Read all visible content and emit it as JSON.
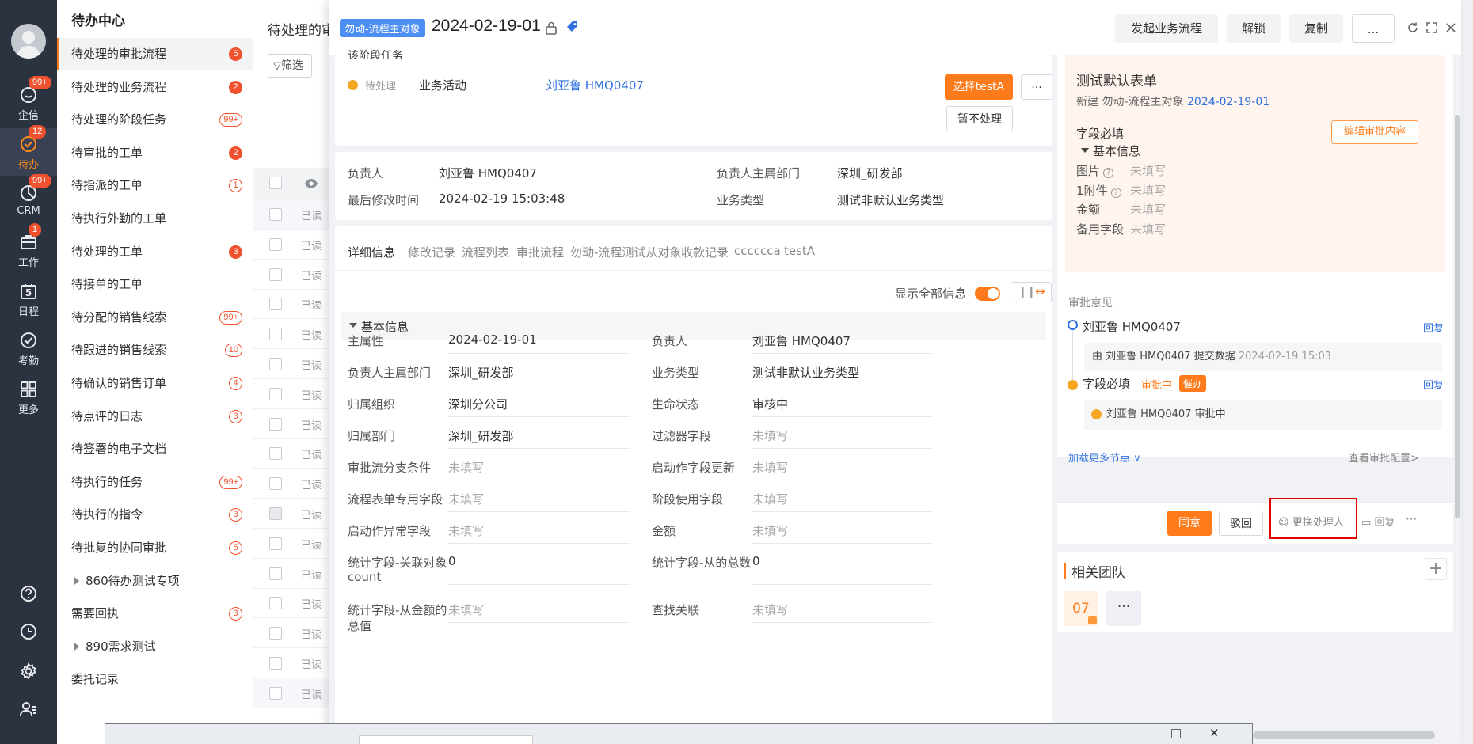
{
  "nav": {
    "items": [
      {
        "label": "企信",
        "badge": "99+",
        "icon": "chat-icon"
      },
      {
        "label": "待办",
        "badge": "12",
        "icon": "todo-icon"
      },
      {
        "label": "CRM",
        "badge": "99+",
        "icon": "crm-icon"
      },
      {
        "label": "工作",
        "badge": "1",
        "icon": "briefcase-icon"
      },
      {
        "label": "日程",
        "day": "5",
        "icon": "calendar-icon"
      },
      {
        "label": "考勤",
        "icon": "attendance-icon"
      },
      {
        "label": "更多",
        "icon": "grid-icon"
      }
    ],
    "bottom": [
      "help-icon",
      "clock-icon",
      "settings-icon",
      "user-list-icon"
    ]
  },
  "sidebar": {
    "title": "待办中心",
    "items": [
      {
        "label": "待处理的审批流程",
        "badge": "5",
        "style": "fill"
      },
      {
        "label": "待处理的业务流程",
        "badge": "2",
        "style": "fill"
      },
      {
        "label": "待处理的阶段任务",
        "badge": "99+",
        "style": "outline"
      },
      {
        "label": "待审批的工单",
        "badge": "2",
        "style": "fill"
      },
      {
        "label": "待指派的工单",
        "badge": "1",
        "style": "outline"
      },
      {
        "label": "待执行外勤的工单",
        "badge": "",
        "style": ""
      },
      {
        "label": "待处理的工单",
        "badge": "3",
        "style": "fill"
      },
      {
        "label": "待接单的工单",
        "badge": "",
        "style": ""
      },
      {
        "label": "待分配的销售线索",
        "badge": "99+",
        "style": "outline"
      },
      {
        "label": "待跟进的销售线索",
        "badge": "10",
        "style": "outline"
      },
      {
        "label": "待确认的销售订单",
        "badge": "4",
        "style": "outline"
      },
      {
        "label": "待点评的日志",
        "badge": "3",
        "style": "outline"
      },
      {
        "label": "待签署的电子文档",
        "badge": "",
        "style": ""
      },
      {
        "label": "待执行的任务",
        "badge": "99+",
        "style": "outline"
      },
      {
        "label": "待执行的指令",
        "badge": "3",
        "style": "outline"
      },
      {
        "label": "待批复的协同审批",
        "badge": "5",
        "style": "outline"
      },
      {
        "label": "860待办测试专项",
        "badge": "",
        "style": "",
        "child": true
      },
      {
        "label": "需要回执",
        "badge": "3",
        "style": "outline"
      },
      {
        "label": "890需求测试",
        "badge": "",
        "style": "",
        "child": true
      },
      {
        "label": "委托记录",
        "badge": "",
        "style": ""
      }
    ]
  },
  "list": {
    "title": "待处理的审",
    "filter": "筛选",
    "row_label": "已读"
  },
  "modal": {
    "tag": "勿动-流程主对象",
    "title": "2024-02-19-01",
    "buttons": {
      "start": "发起业务流程",
      "unlock": "解锁",
      "copy": "复制",
      "more": "..."
    },
    "stage": {
      "header": "该阶段任务",
      "status": "待处理",
      "activity": "业务活动",
      "person": "刘亚鲁 HMQ0407",
      "select_btn": "选择testA",
      "more": "···",
      "skip_btn": "暂不处理"
    },
    "summary": {
      "owner_label": "负责人",
      "owner": "刘亚鲁 HMQ0407",
      "dept_label": "负责人主属部门",
      "dept": "深圳_研发部",
      "modified_label": "最后修改时间",
      "modified": "2024-02-19 15:03:48",
      "biztype_label": "业务类型",
      "biztype": "测试非默认业务类型"
    },
    "tabs": [
      "详细信息",
      "修改记录",
      "流程列表",
      "审批流程",
      "勿动-流程测试从对象",
      "收款记录",
      "cccccca",
      "testA"
    ],
    "show_all": "显示全部信息",
    "section": "基本信息",
    "fields": [
      [
        {
          "label": "主属性",
          "value": "2024-02-19-01"
        },
        {
          "label": "负责人",
          "value": "刘亚鲁 HMQ0407"
        }
      ],
      [
        {
          "label": "负责人主属部门",
          "value": "深圳_研发部"
        },
        {
          "label": "业务类型",
          "value": "测试非默认业务类型"
        }
      ],
      [
        {
          "label": "归属组织",
          "value": "深圳分公司"
        },
        {
          "label": "生命状态",
          "value": "审核中"
        }
      ],
      [
        {
          "label": "归属部门",
          "value": "深圳_研发部"
        },
        {
          "label": "过滤器字段",
          "value": "未填写"
        }
      ],
      [
        {
          "label": "审批流分支条件",
          "value": "未填写"
        },
        {
          "label": "启动作字段更新",
          "value": "未填写"
        }
      ],
      [
        {
          "label": "流程表单专用字段",
          "value": "未填写"
        },
        {
          "label": "阶段使用字段",
          "value": "未填写"
        }
      ],
      [
        {
          "label": "启动作异常字段",
          "value": "未填写"
        },
        {
          "label": "金额",
          "value": "未填写"
        }
      ],
      [
        {
          "label": "统计字段-关联对象count",
          "label_a": "统计字段-关联对象",
          "label_b": "count",
          "value": "0"
        },
        {
          "label": "统计字段-从的总数",
          "value": "0"
        }
      ],
      [
        {
          "label": "统计字段-从金额的总值",
          "label_a": "统计字段-从金额的",
          "label_b": "总值",
          "value": "未填写"
        },
        {
          "label": "查找关联",
          "value": "未填写"
        }
      ]
    ],
    "empty_text": "未填写"
  },
  "approval": {
    "form_title": "测试默认表单",
    "form_sub_prefix": "新建 勿动-流程主对象",
    "form_sub_link": "2024-02-19-01",
    "required_label": "字段必填",
    "edit_btn": "编辑审批内容",
    "section": "基本信息",
    "form_fields": [
      {
        "label": "图片",
        "value": "未填写",
        "help": true
      },
      {
        "label": "1附件",
        "value": "未填写",
        "help": true
      },
      {
        "label": "金额",
        "value": "未填写"
      },
      {
        "label": "备用字段",
        "value": "未填写"
      }
    ],
    "opinion_title": "审批意见",
    "nodes": [
      {
        "name": "刘亚鲁 HMQ0407",
        "reply": "回复",
        "detail_prefix": "由 刘亚鲁 HMQ0407 提交数据",
        "detail_time": "2024-02-19 15:03"
      },
      {
        "name": "字段必填",
        "status": "审批中",
        "urge": "催办",
        "reply": "回复",
        "detail": "刘亚鲁 HMQ0407  审批中"
      }
    ],
    "load_more": "加载更多节点",
    "view_config": "查看审批配置>",
    "actions": {
      "agree": "同意",
      "reject": "驳回",
      "change": "更换处理人",
      "reply": "回复",
      "more": "···"
    },
    "team_title": "相关团队",
    "team_member": "07",
    "team_more": "···"
  },
  "colors": {
    "accent": "#ff7a1a",
    "link": "#2f6fde",
    "nav_bg": "#2b3240",
    "highlight": "#e60000"
  }
}
